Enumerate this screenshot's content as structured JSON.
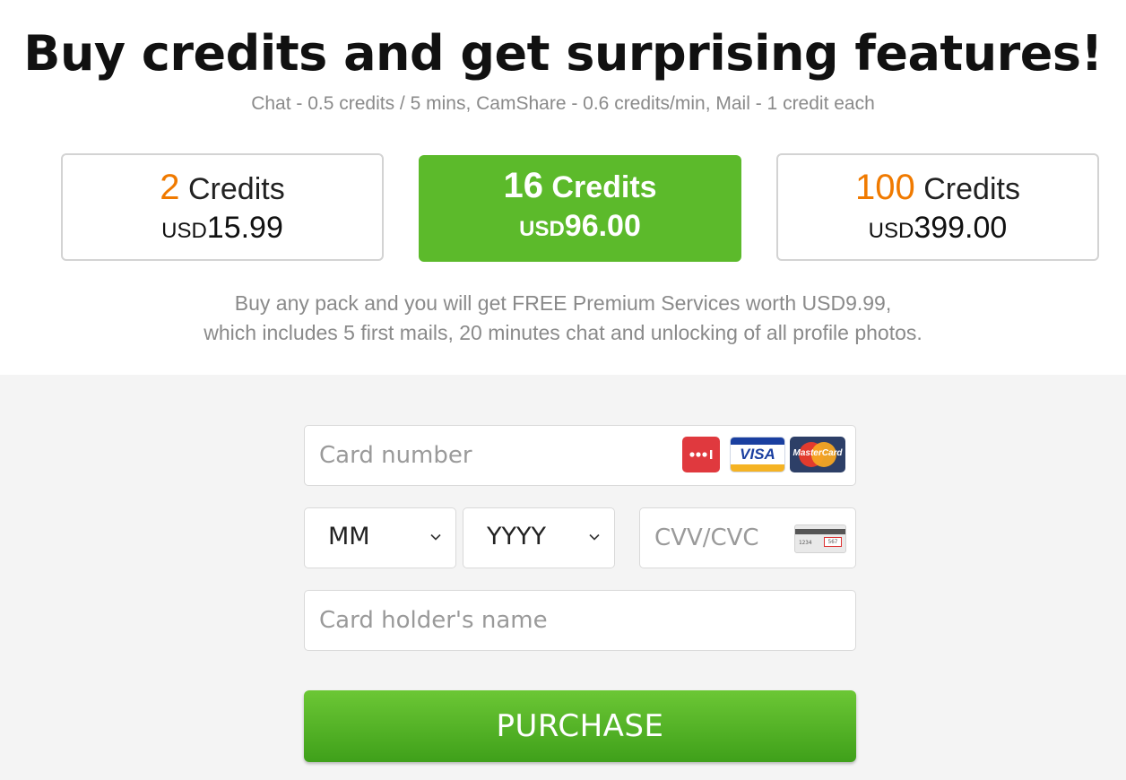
{
  "header": {
    "title": "Buy credits and get surprising features!",
    "subtitle": "Chat - 0.5 credits / 5 mins, CamShare - 0.6 credits/min, Mail - 1 credit each"
  },
  "packages": [
    {
      "amount": "2",
      "unit": "Credits",
      "currency": "USD",
      "price": "15.99",
      "selected": false
    },
    {
      "amount": "16",
      "unit": "Credits",
      "currency": "USD",
      "price": "96.00",
      "selected": true
    },
    {
      "amount": "100",
      "unit": "Credits",
      "currency": "USD",
      "price": "399.00",
      "selected": false
    }
  ],
  "promo": {
    "line1": "Buy any pack and you will get FREE Premium Services worth USD9.99,",
    "line2": "which includes 5 first mails, 20 minutes chat and unlocking of all profile photos."
  },
  "form": {
    "card_number_placeholder": "Card number",
    "month_value": "MM",
    "year_value": "YYYY",
    "cvv_placeholder": "CVV/CVC",
    "holder_placeholder": "Card holder's name",
    "card_logos": [
      "generic-card-icon",
      "visa-logo",
      "mastercard-logo"
    ],
    "visa_text": "VISA",
    "mastercard_text": "MasterCard",
    "cvv_card_number": "1234",
    "cvv_sample": "567"
  },
  "purchase_label": "PURCHASE",
  "colors": {
    "accent_green": "#5cba2b",
    "credit_orange": "#f07a00",
    "muted_text": "#8a8a8a"
  }
}
